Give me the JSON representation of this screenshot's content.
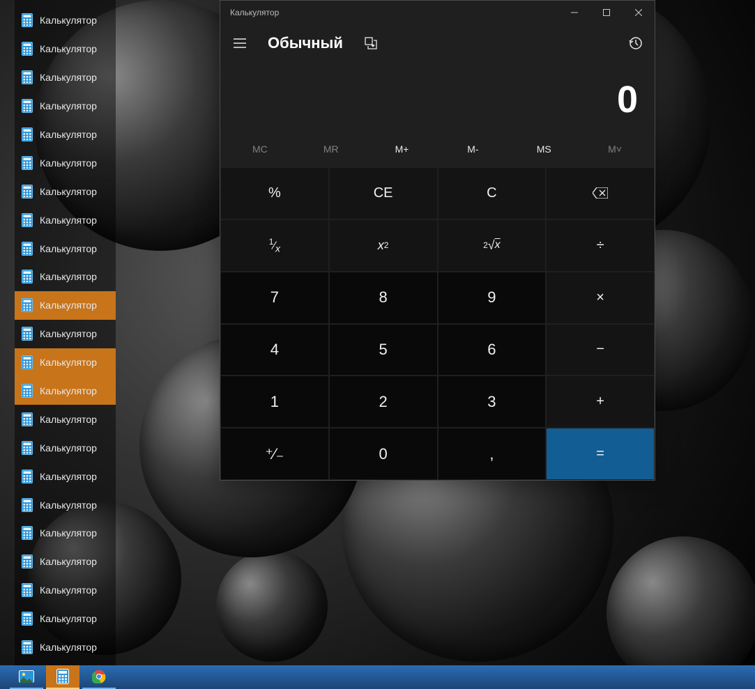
{
  "tasklist": {
    "item_label": "Калькулятор",
    "count": 23,
    "selected_indices": [
      10,
      12,
      13
    ]
  },
  "calc": {
    "title": "Калькулятор",
    "mode": "Обычный",
    "display": "0",
    "memory": {
      "mc": "MC",
      "mr": "MR",
      "mplus": "M+",
      "mminus": "M-",
      "ms": "MS",
      "mlist": "M˅",
      "mc_enabled": false,
      "mr_enabled": false,
      "mlist_enabled": false
    },
    "keys": {
      "percent": "%",
      "ce": "CE",
      "c": "C",
      "back": "⌫",
      "recip": "¹⁄ₓ",
      "sqr": "x²",
      "sqrt": "²√x",
      "div": "÷",
      "n7": "7",
      "n8": "8",
      "n9": "9",
      "mul": "×",
      "n4": "4",
      "n5": "5",
      "n6": "6",
      "sub": "−",
      "n1": "1",
      "n2": "2",
      "n3": "3",
      "add": "+",
      "neg": "⁺⁄₋",
      "n0": "0",
      "dec": ",",
      "eq": "="
    }
  },
  "taskbar": {
    "items": [
      {
        "name": "photos-icon",
        "active": false,
        "running": true
      },
      {
        "name": "calculator-icon",
        "active": true,
        "running": true
      },
      {
        "name": "chrome-icon",
        "active": false,
        "running": true
      }
    ]
  },
  "colors": {
    "accent": "#125d94",
    "selection": "#c8741a"
  }
}
